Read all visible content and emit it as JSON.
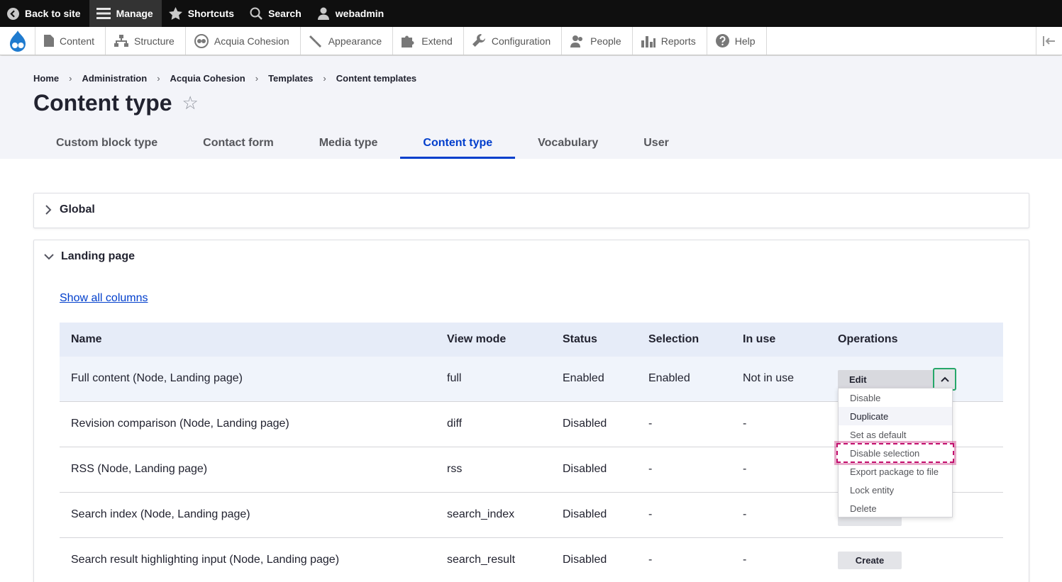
{
  "toolbar": {
    "back": "Back to site",
    "manage": "Manage",
    "shortcuts": "Shortcuts",
    "search": "Search",
    "user": "webadmin"
  },
  "tray": {
    "items": [
      "Content",
      "Structure",
      "Acquia Cohesion",
      "Appearance",
      "Extend",
      "Configuration",
      "People",
      "Reports",
      "Help"
    ]
  },
  "breadcrumb": [
    "Home",
    "Administration",
    "Acquia Cohesion",
    "Templates",
    "Content templates"
  ],
  "page_title": "Content type",
  "tabs": [
    "Custom block type",
    "Contact form",
    "Media type",
    "Content type",
    "Vocabulary",
    "User"
  ],
  "active_tab": "Content type",
  "sections": {
    "global": "Global",
    "landing": "Landing page"
  },
  "show_all_columns": "Show all columns",
  "table": {
    "headers": [
      "Name",
      "View mode",
      "Status",
      "Selection",
      "In use",
      "Operations"
    ],
    "rows": [
      {
        "name": "Full content (Node, Landing page)",
        "view_mode": "full",
        "status": "Enabled",
        "selection": "Enabled",
        "in_use": "Not in use"
      },
      {
        "name": "Revision comparison (Node, Landing page)",
        "view_mode": "diff",
        "status": "Disabled",
        "selection": "-",
        "in_use": "-"
      },
      {
        "name": "RSS (Node, Landing page)",
        "view_mode": "rss",
        "status": "Disabled",
        "selection": "-",
        "in_use": "-"
      },
      {
        "name": "Search index (Node, Landing page)",
        "view_mode": "search_index",
        "status": "Disabled",
        "selection": "-",
        "in_use": "-"
      },
      {
        "name": "Search result highlighting input (Node, Landing page)",
        "view_mode": "search_result",
        "status": "Disabled",
        "selection": "-",
        "in_use": "-",
        "operation": "Create"
      }
    ]
  },
  "dropbutton": {
    "primary": "Edit",
    "items": [
      "Disable",
      "Duplicate",
      "Set as default",
      "Disable selection",
      "Export package to file",
      "Lock entity",
      "Delete"
    ],
    "hovered": "Duplicate",
    "focused": "Disable selection"
  },
  "colors": {
    "accent": "#003ecc",
    "focus_ring": "#c3106e",
    "toggle_border": "#26a769"
  }
}
